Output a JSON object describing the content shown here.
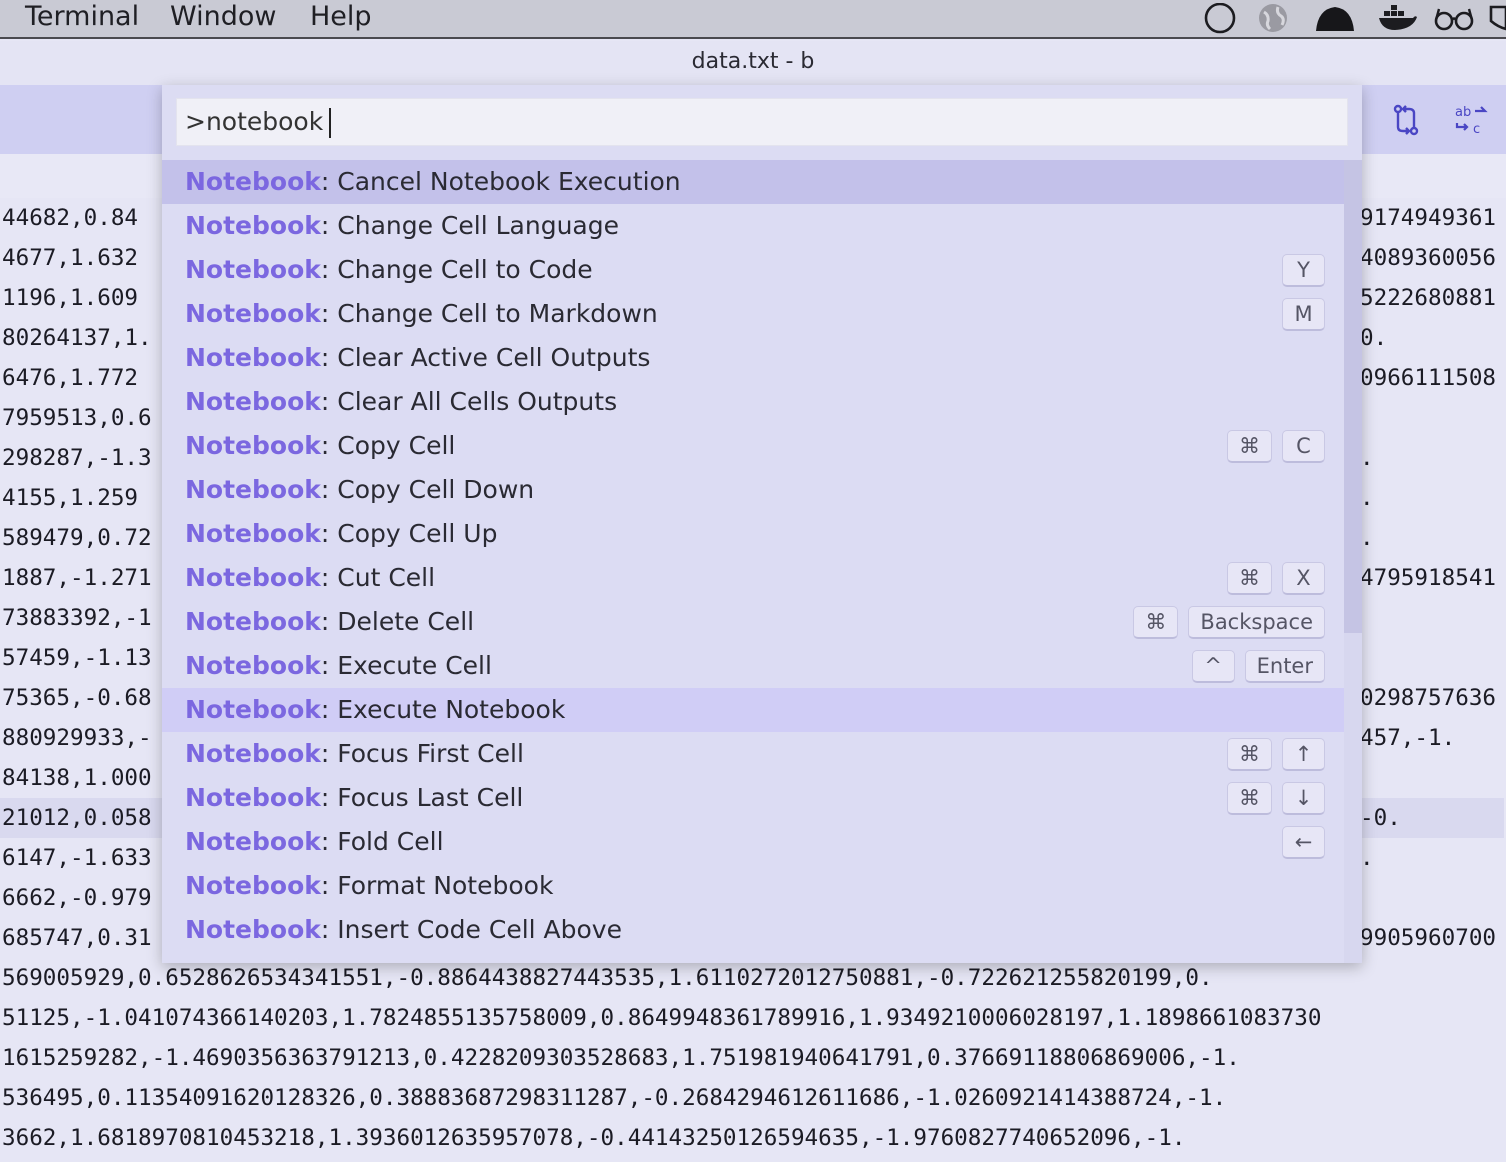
{
  "menubar": {
    "items": [
      "Terminal",
      "Window",
      "Help"
    ],
    "tray_icons": [
      "circle-icon",
      "globe-icon",
      "bell-icon",
      "docker-icon",
      "glasses-icon",
      "shield-icon"
    ]
  },
  "window": {
    "title": "data.txt - b"
  },
  "toolbar": {
    "icons": [
      "compare-changes-icon",
      "replace-icon"
    ]
  },
  "editor": {
    "lines": [
      "44682,0.84",
      "4677,1.632",
      "1196,1.609",
      "80264137,1.",
      "6476,1.772",
      "7959513,0.6",
      "298287,-1.3",
      "4155,1.259",
      "589479,0.72",
      "1887,-1.271",
      "73883392,-1",
      "57459,-1.13",
      "75365,-0.68",
      "880929933,-",
      "84138,1.000",
      "21012,0.058",
      "6147,-1.633",
      "6662,-0.979",
      "685747,0.31",
      "569005929,0.6528626534341551,-0.8864438827443535,1.6110272012750881,-0.722621255820199,0.",
      "51125,-1.041074366140203,1.7824855135758009,0.8649948361789916,1.9349210006028197,1.1898661083730",
      "1615259282,-1.4690356363791213,0.4228209303528683,1.751981940641791,0.37669118806869006,-1.",
      "536495,0.11354091620128326,0.38883687298311287,-0.2684294612611686,-1.0260921414388724,-1.",
      "3662,1.6818970810453218,1.3936012635957078,-0.44143250126594635,-1.9760827740652096,-1."
    ],
    "right_fragments": [
      "9174949361",
      "4089360056",
      "5222680881",
      "0.",
      "0966111508",
      "",
      ".",
      ".",
      ".",
      "4795918541",
      "",
      "",
      "0298757636",
      "457,-1.",
      "",
      "-0.",
      ".",
      "",
      "9905960700"
    ]
  },
  "palette": {
    "query": ">notebook",
    "prefix": "Notebook",
    "results": [
      {
        "title": "Cancel Notebook Execution",
        "keys": []
      },
      {
        "title": "Change Cell Language",
        "keys": []
      },
      {
        "title": "Change Cell to Code",
        "keys": [
          "Y"
        ]
      },
      {
        "title": "Change Cell to Markdown",
        "keys": [
          "M"
        ]
      },
      {
        "title": "Clear Active Cell Outputs",
        "keys": []
      },
      {
        "title": "Clear All Cells Outputs",
        "keys": []
      },
      {
        "title": "Copy Cell",
        "keys": [
          "⌘",
          "C"
        ]
      },
      {
        "title": "Copy Cell Down",
        "keys": []
      },
      {
        "title": "Copy Cell Up",
        "keys": []
      },
      {
        "title": "Cut Cell",
        "keys": [
          "⌘",
          "X"
        ]
      },
      {
        "title": "Delete Cell",
        "keys": [
          "⌘",
          "Backspace"
        ]
      },
      {
        "title": "Execute Cell",
        "keys": [
          "^",
          "Enter"
        ]
      },
      {
        "title": "Execute Notebook",
        "keys": []
      },
      {
        "title": "Focus First Cell",
        "keys": [
          "⌘",
          "↑"
        ]
      },
      {
        "title": "Focus Last Cell",
        "keys": [
          "⌘",
          "↓"
        ]
      },
      {
        "title": "Fold Cell",
        "keys": [
          "←"
        ]
      },
      {
        "title": "Format Notebook",
        "keys": []
      },
      {
        "title": "Insert Code Cell Above",
        "keys": []
      }
    ]
  }
}
